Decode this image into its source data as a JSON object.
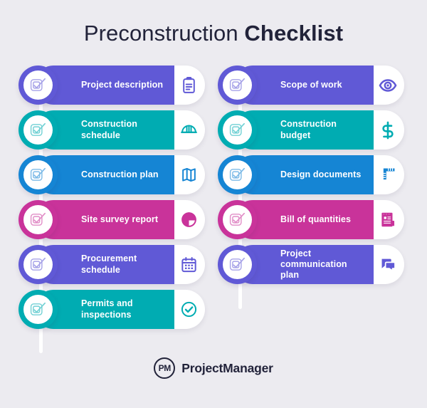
{
  "page": {
    "title_light": "Preconstruction",
    "title_bold": "Checklist",
    "background_color": "#ECEBF0"
  },
  "colors": {
    "purple": "#6059D6",
    "teal": "#00ACB2",
    "blue": "#1585D4",
    "magenta": "#C9339A",
    "text_dark": "#22233A",
    "white": "#FFFFFF"
  },
  "columns": [
    {
      "name": "left-column",
      "items": [
        {
          "label": "Project description",
          "color": "#6059D6",
          "badge_icon": "checkbox-check-icon",
          "end_icon": "clipboard-icon"
        },
        {
          "label": "Construction\nschedule",
          "color": "#00ACB2",
          "badge_icon": "checkbox-check-icon",
          "end_icon": "hard-hat-icon"
        },
        {
          "label": "Construction plan",
          "color": "#1585D4",
          "badge_icon": "checkbox-check-icon",
          "end_icon": "map-icon"
        },
        {
          "label": "Site survey report",
          "color": "#C9339A",
          "badge_icon": "checkbox-check-icon",
          "end_icon": "pie-chart-icon"
        },
        {
          "label": "Procurement\nschedule",
          "color": "#6059D6",
          "badge_icon": "checkbox-check-icon",
          "end_icon": "calendar-icon"
        },
        {
          "label": "Permits and\ninspections",
          "color": "#00ACB2",
          "badge_icon": "checkbox-check-icon",
          "end_icon": "check-circle-icon"
        }
      ]
    },
    {
      "name": "right-column",
      "items": [
        {
          "label": "Scope of work",
          "color": "#6059D6",
          "badge_icon": "checkbox-check-icon",
          "end_icon": "eye-icon"
        },
        {
          "label": "Construction\nbudget",
          "color": "#00ACB2",
          "badge_icon": "checkbox-check-icon",
          "end_icon": "dollar-sign-icon"
        },
        {
          "label": "Design documents",
          "color": "#1585D4",
          "badge_icon": "checkbox-check-icon",
          "end_icon": "ruler-square-icon"
        },
        {
          "label": "Bill of quantities",
          "color": "#C9339A",
          "badge_icon": "checkbox-check-icon",
          "end_icon": "invoice-icon"
        },
        {
          "label": "Project\ncommunication plan",
          "color": "#6059D6",
          "badge_icon": "checkbox-check-icon",
          "end_icon": "chat-bubbles-icon"
        }
      ]
    }
  ],
  "footer": {
    "logo_mark": "PM",
    "logo_text": "ProjectManager"
  }
}
